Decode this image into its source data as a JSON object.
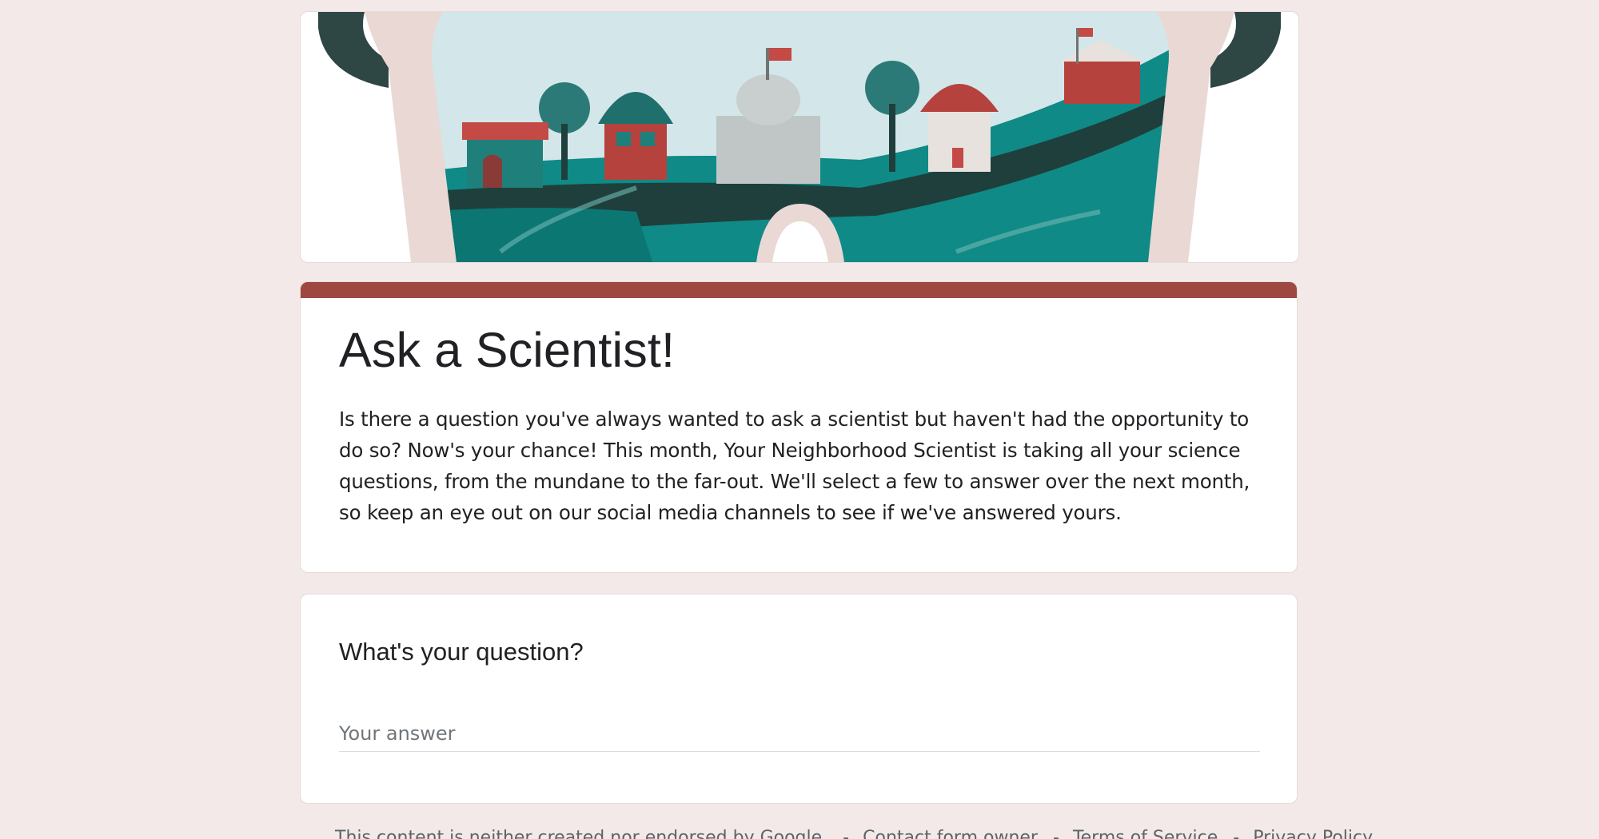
{
  "form": {
    "title": "Ask a Scientist!",
    "description": "Is there a question you've always wanted to ask a scientist but haven't had the opportunity to do so? Now's your chance! This month, Your Neighborhood Scientist is taking all your science questions, from the mundane to the far-out. We'll select a few to answer over the next month, so keep an eye out on our social media channels to see if we've answered yours."
  },
  "question": {
    "label": "What's your question?",
    "placeholder": "Your answer"
  },
  "footer": {
    "disclaimer": "This content is neither created nor endorsed by Google.",
    "contact": "Contact form owner",
    "terms": "Terms of Service",
    "privacy": "Privacy Policy",
    "separator": "-"
  },
  "colors": {
    "background": "#f2e9e8",
    "accent": "#9d4942",
    "teal": "#0f8a86",
    "dark_teal": "#1f3f3c",
    "sky": "#d3e6e9"
  },
  "header_image": {
    "icon": "neighborhood-glasses-illustration"
  }
}
